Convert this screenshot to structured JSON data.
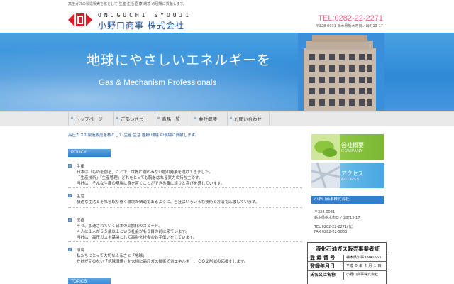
{
  "site": {
    "tagline": "高圧ガスの製造販売を核として 生産 生活 医療 環境 の現場に貢献します。",
    "logo_roman": "ONOGUCHI SYOUJI",
    "logo_jp": "小野口商事 株式会社",
    "tel": "TEL:0282-22-2271",
    "address": "〒328-0031 栃木県栃木市日ノ出町13-17"
  },
  "hero": {
    "title": "地球にやさしいエネルギーを",
    "subtitle": "Gas & Mechanism Professionals"
  },
  "nav": {
    "items": [
      {
        "label": "トップページ"
      },
      {
        "label": "ごあいさつ"
      },
      {
        "label": "商品一覧"
      },
      {
        "label": "会社概要"
      },
      {
        "label": "お問い合わせ"
      }
    ]
  },
  "main": {
    "intro": "高圧ガスの製造販売を核として 生産 生活 医療 環境 の現場に貢献します。",
    "policy_heading": "POLICY",
    "topics_heading": "TOPICS",
    "policy": [
      {
        "title": "生産",
        "lines": [
          "日本は「ものを創る」ことで、世界に例のみない程の発展を遂げてきました。",
          "「生産技術」「生産管理」どれをとっても胸をはれる実力の持ち主です。",
          "当社は、そんな生産の現場に身を置くことができる事に誇りと喜びを感じています。"
        ]
      },
      {
        "title": "生活",
        "lines": [
          "快適な生活とそれを取り巻く環境が快適であるように、当社はいろいろな技術と方法で応援しています。"
        ]
      },
      {
        "title": "医療",
        "lines": [
          "年々、加速されていく日本の高齢化のスピード。",
          "４人に１人が６５歳以上という社会がもう目の前に来ています。",
          "当社は、高圧ガスを基盤として高齢化社会のお手伝いをしています。"
        ]
      },
      {
        "title": "環境",
        "lines": [
          "私たちにとって大切なふるさと「地球」",
          "かけがえのない「地球環境」を大切に高圧ガス技術で省エネルギー、ＣＯ２削減の応援をします。"
        ]
      }
    ]
  },
  "sidebar": {
    "banners": [
      {
        "label": "会社概要",
        "sub": "COMPANY"
      },
      {
        "label": "アクセス",
        "sub": "ACCESS"
      }
    ],
    "company_heading": "小野口商事株式会社",
    "company_lines": [
      "〒328-0031",
      "栃木県栃木市日ノ出町13-17",
      "",
      "TEL 0282-22-2271(代)",
      "FAX 0282-22-5863"
    ]
  },
  "license": {
    "title": "液化石油ガス販売事業者証",
    "rows": [
      {
        "key": "登 録 番 号",
        "value": "栃木県知事 09A1663"
      },
      {
        "key": "登録年月日",
        "value": "平成 ９ 年 ４ 月 １ 日"
      },
      {
        "key": "氏名又は名称",
        "value": "小野口商事株式会社"
      }
    ]
  },
  "colors": {
    "brand_blue": "#1a4fa0",
    "accent_pink": "#e26a86",
    "hero_blue": "#2f89d6"
  }
}
